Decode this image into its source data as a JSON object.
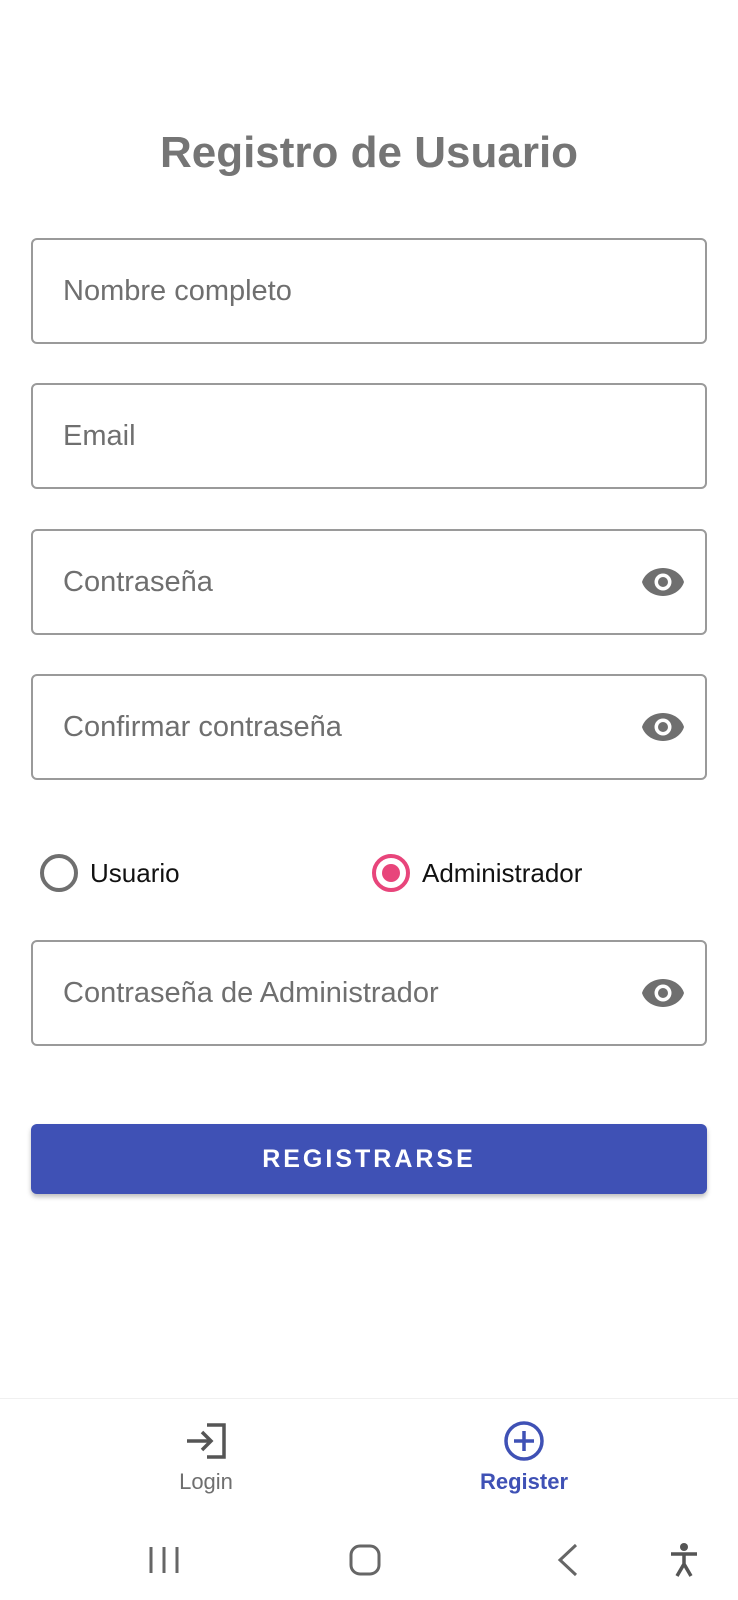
{
  "form": {
    "title": "Registro de Usuario",
    "fields": {
      "full_name": {
        "placeholder": "Nombre completo",
        "value": ""
      },
      "email": {
        "placeholder": "Email",
        "value": ""
      },
      "password": {
        "placeholder": "Contraseña",
        "value": ""
      },
      "confirm_password": {
        "placeholder": "Confirmar contraseña",
        "value": ""
      },
      "admin_password": {
        "placeholder": "Contraseña de Administrador",
        "value": ""
      }
    },
    "role": {
      "options": [
        "Usuario",
        "Administrador"
      ],
      "selected": "Administrador"
    },
    "submit_label": "REGISTRARSE"
  },
  "bottom_nav": {
    "items": [
      {
        "label": "Login",
        "icon": "login-icon",
        "active": false
      },
      {
        "label": "Register",
        "icon": "add-circle-icon",
        "active": true
      }
    ]
  },
  "system_nav": {
    "icons": [
      "recent-apps-icon",
      "home-icon",
      "back-icon",
      "accessibility-icon"
    ]
  },
  "colors": {
    "primary": "#3f51b5",
    "accent": "#e8457b",
    "title": "#757575",
    "icon": "#6f6f6f"
  }
}
